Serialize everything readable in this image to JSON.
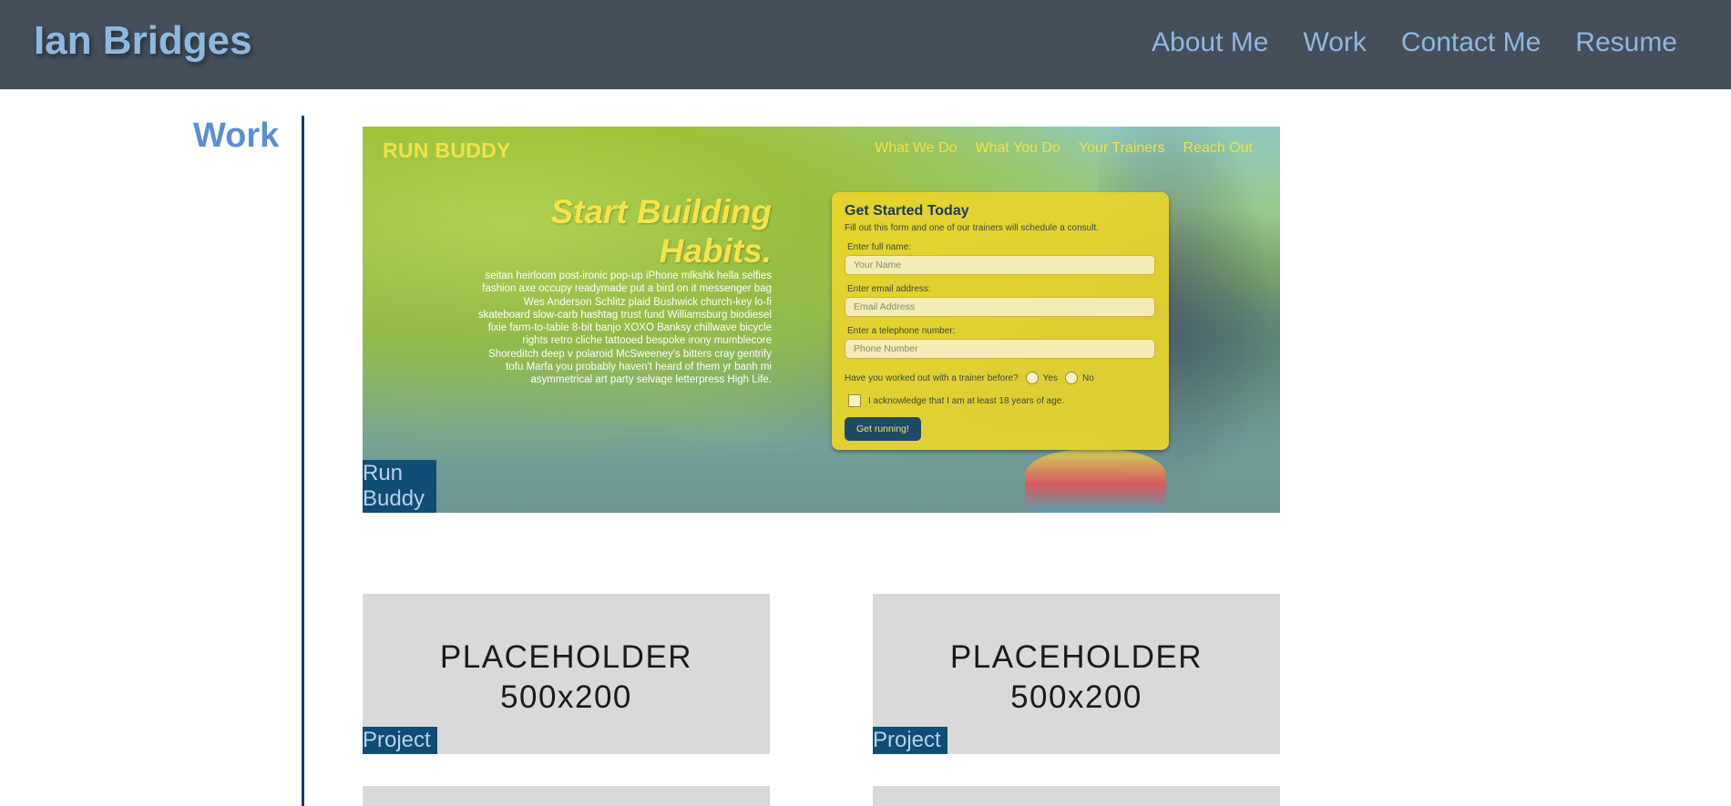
{
  "header": {
    "brand": "Ian Bridges",
    "nav": [
      "About Me",
      "Work",
      "Contact Me",
      "Resume"
    ]
  },
  "work": {
    "title": "Work",
    "featured": {
      "label": "Run Buddy",
      "screenshot": {
        "logo": "RUN BUDDY",
        "nav": [
          "What We Do",
          "What You Do",
          "Your Trainers",
          "Reach Out"
        ],
        "headline_line1": "Start Building",
        "headline_line2": "Habits.",
        "body": "seitan heirloom post-ironic pop-up iPhone mlkshk hella selfies fashion axe occupy readymade put a bird on it messenger bag Wes Anderson Schlitz plaid Bushwick church-key lo-fi skateboard slow-carb hashtag trust fund Williamsburg biodiesel fixie farm-to-table 8-bit banjo XOXO Banksy chillwave bicycle rights retro cliche tattooed bespoke irony mumblecore Shoreditch deep v polaroid McSweeney's bitters cray gentrify tofu Marfa you probably haven't heard of them yr banh mi asymmetrical art party selvage letterpress High Life.",
        "form": {
          "title": "Get Started Today",
          "subtitle": "Fill out this form and one of our trainers will schedule a consult.",
          "name_label": "Enter full name:",
          "name_placeholder": "Your Name",
          "email_label": "Enter email address:",
          "email_placeholder": "Email Address",
          "phone_label": "Enter a telephone number:",
          "phone_placeholder": "Phone Number",
          "question": "Have you worked out with a trainer before?",
          "yes": "Yes",
          "no": "No",
          "ack": "I acknowledge that I am at least 18 years of age.",
          "button": "Get running!"
        }
      }
    },
    "projects": [
      {
        "placeholder_line1": "PLACEHOLDER",
        "placeholder_line2": "500x200",
        "label": "Project"
      },
      {
        "placeholder_line1": "PLACEHOLDER",
        "placeholder_line2": "500x200",
        "label": "Project"
      }
    ]
  }
}
